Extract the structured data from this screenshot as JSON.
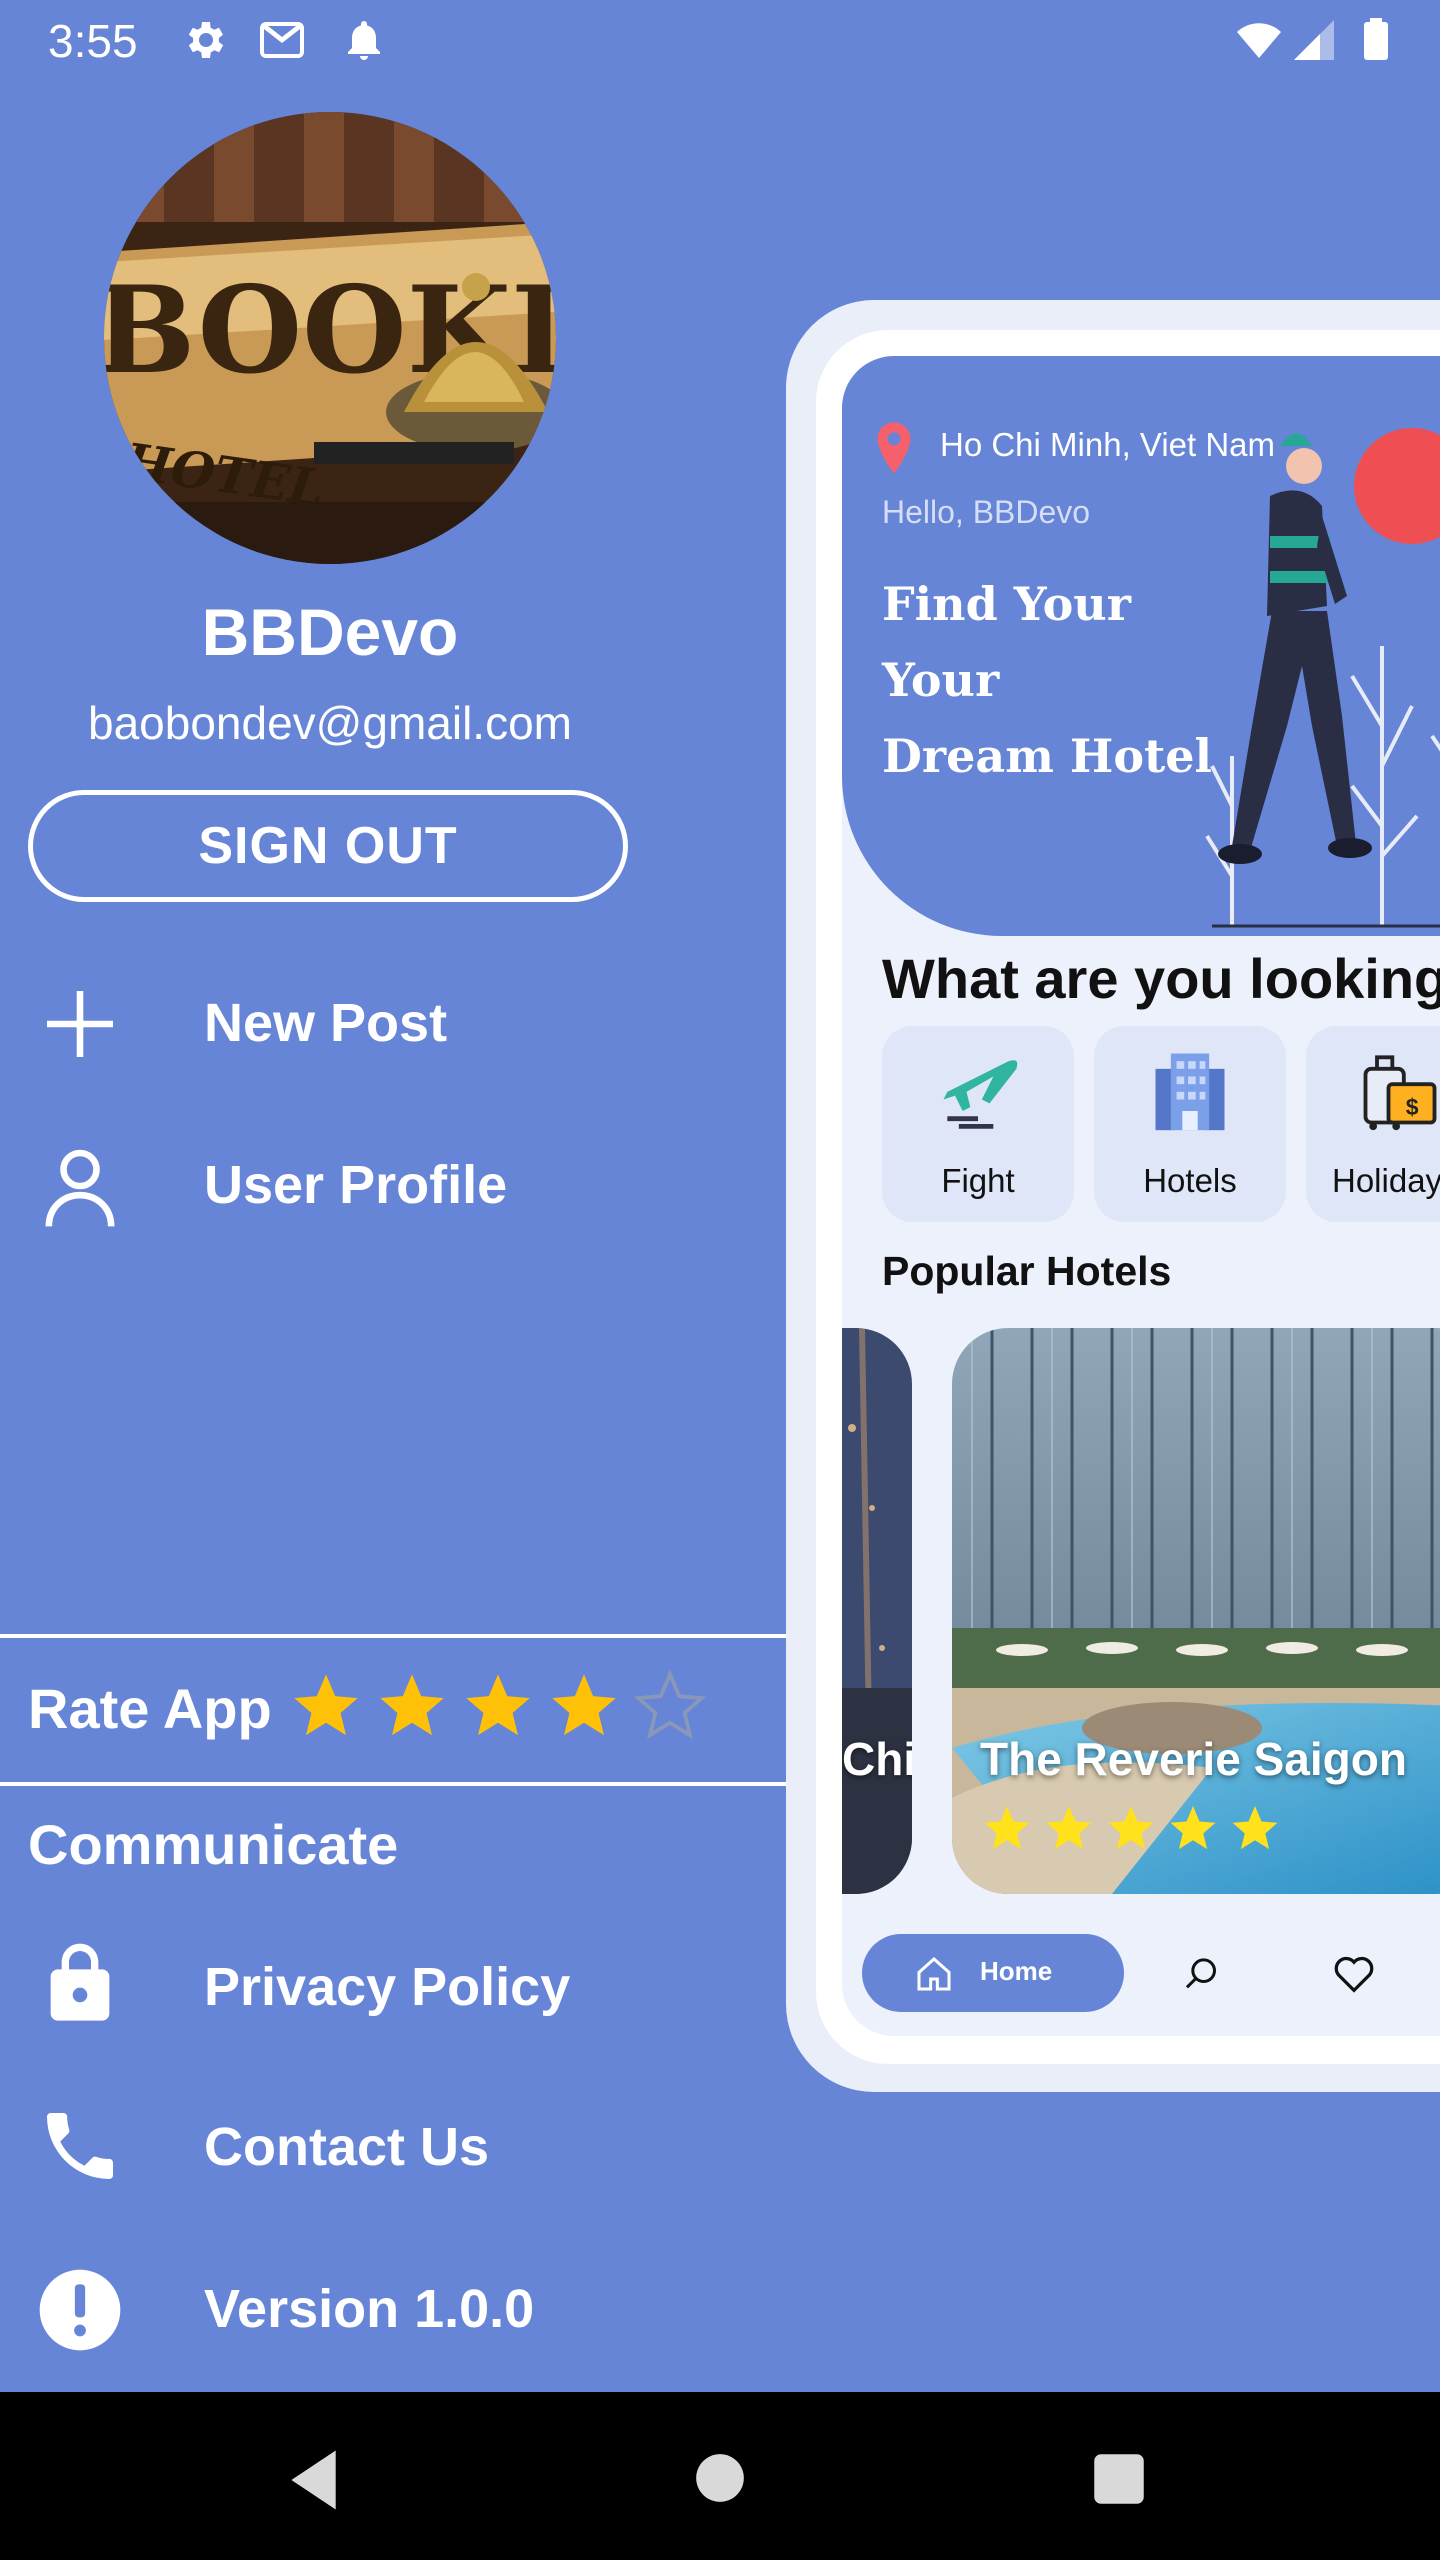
{
  "status_bar": {
    "time": "3:55",
    "left_icons": [
      "settings-icon",
      "gmail-icon",
      "notification-bell-icon"
    ],
    "right_icons": [
      "wifi-icon",
      "cell-signal-icon",
      "battery-icon"
    ]
  },
  "drawer": {
    "avatar_image": "booking-hotel-bell-photo",
    "user_name": "BBDevo",
    "user_email": "baobondev@gmail.com",
    "sign_out_label": "SIGN OUT",
    "menu_items": [
      {
        "icon": "plus-icon",
        "label": "New Post"
      },
      {
        "icon": "person-icon",
        "label": "User Profile"
      }
    ],
    "rate_app": {
      "label": "Rate App",
      "rating": 4,
      "max": 5,
      "star_color": "#ffc107"
    },
    "communicate": {
      "title": "Communicate",
      "items": [
        {
          "icon": "lock-icon",
          "label": "Privacy Policy"
        },
        {
          "icon": "phone-icon",
          "label": "Contact Us"
        },
        {
          "icon": "exclamation-icon",
          "label": "Version 1.0.0"
        }
      ]
    }
  },
  "preview": {
    "location": "Ho Chi Minh, Viet Nam",
    "greeting": "Hello, BBDevo",
    "hero_lines": [
      "Find Your",
      "Your",
      "Dream Hotel"
    ],
    "section_title": "What are you looking",
    "categories": [
      {
        "icon": "airplane-icon",
        "label": "Fight"
      },
      {
        "icon": "hotel-building-icon",
        "label": "Hotels"
      },
      {
        "icon": "luggage-icon",
        "label": "Holiday"
      }
    ],
    "popular_title": "Popular Hotels",
    "hotels": [
      {
        "name": "Chi",
        "rating": 0
      },
      {
        "name": "The Reverie Saigon",
        "rating": 5
      }
    ],
    "bottom_nav": {
      "home_label": "Home"
    }
  },
  "colors": {
    "background": "#6685d7",
    "accent_star": "#ffc107",
    "hotel_star": "#ffe11c"
  }
}
